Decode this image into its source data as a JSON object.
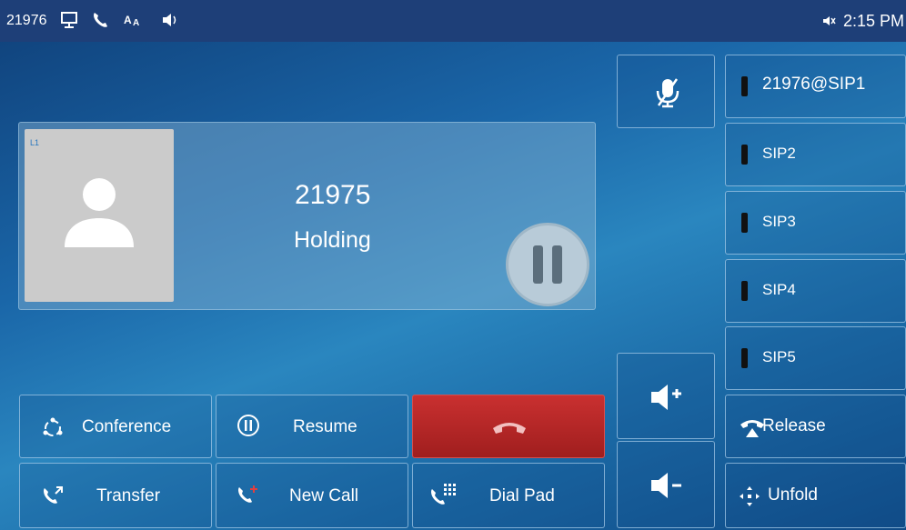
{
  "status_bar": {
    "extension": "21976",
    "time": "2:15 PM",
    "icons": [
      "monitor-icon",
      "phone-icon",
      "text-size-icon",
      "speaker-icon",
      "mute-icon"
    ]
  },
  "call": {
    "line_tag": "L1",
    "number": "21975",
    "state": "Holding"
  },
  "actions": {
    "conference": "Conference",
    "resume": "Resume",
    "transfer": "Transfer",
    "new_call": "New Call",
    "dial_pad": "Dial Pad"
  },
  "lines": [
    "21976@SIP1",
    "SIP2",
    "SIP3",
    "SIP4",
    "SIP5"
  ],
  "side": {
    "release": "Release",
    "unfold": "Unfold"
  },
  "colors": {
    "status_bar": "#1e3f78",
    "end_call": "#b02424",
    "avatar": "#cbcbcb"
  }
}
